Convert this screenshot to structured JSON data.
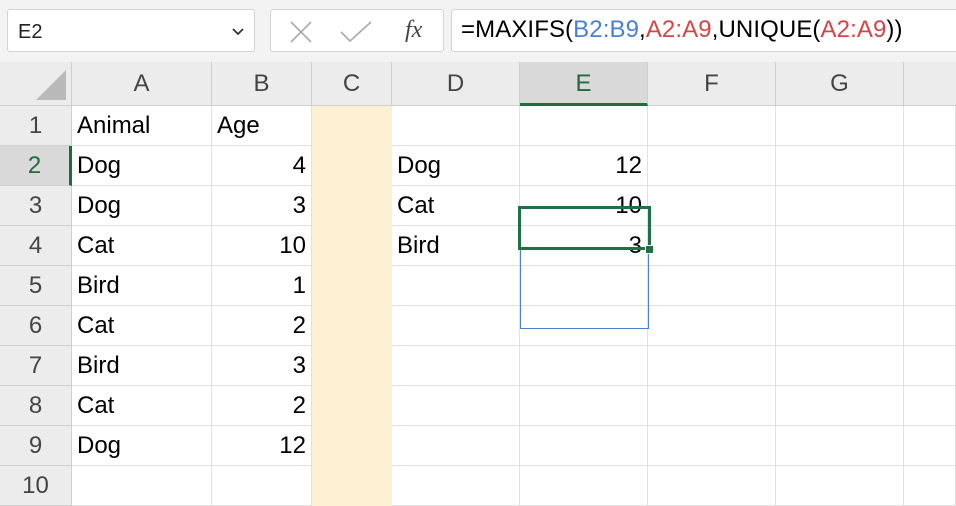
{
  "name_box": {
    "value": "E2",
    "dropdown_icon": "chevron-down-icon"
  },
  "formula_bar": {
    "cancel_icon": "close-icon",
    "enter_icon": "checkmark-icon",
    "fx_label": "fx",
    "formula_parts": [
      {
        "text": "=MAXIFS(",
        "color": "#000000"
      },
      {
        "text": "B2:B9",
        "color": "#4a7fd6"
      },
      {
        "text": ",",
        "color": "#000000"
      },
      {
        "text": "A2:A9",
        "color": "#d64545"
      },
      {
        "text": ",UNIQUE(",
        "color": "#000000"
      },
      {
        "text": "A2:A9",
        "color": "#d64545"
      },
      {
        "text": "))",
        "color": "#000000"
      }
    ]
  },
  "columns": [
    "A",
    "B",
    "C",
    "D",
    "E",
    "F",
    "G"
  ],
  "rows": [
    "1",
    "2",
    "3",
    "4",
    "5",
    "6",
    "7",
    "8",
    "9",
    "10"
  ],
  "selected_cell": {
    "column": "E",
    "row": "2"
  },
  "colors": {
    "selection": "#1e7145",
    "spill_border": "#4a7fd6",
    "column_c_fill": "#fef1d3"
  },
  "cells": {
    "A1": "Animal",
    "B1": "Age",
    "A2": "Dog",
    "B2": "4",
    "A3": "Dog",
    "B3": "3",
    "A4": "Cat",
    "B4": "10",
    "A5": "Bird",
    "B5": "1",
    "A6": "Cat",
    "B6": "2",
    "A7": "Bird",
    "B7": "3",
    "A8": "Cat",
    "B8": "2",
    "A9": "Dog",
    "B9": "12",
    "D2": "Dog",
    "E2": "12",
    "D3": "Cat",
    "E3": "10",
    "D4": "Bird",
    "E4": "3"
  }
}
